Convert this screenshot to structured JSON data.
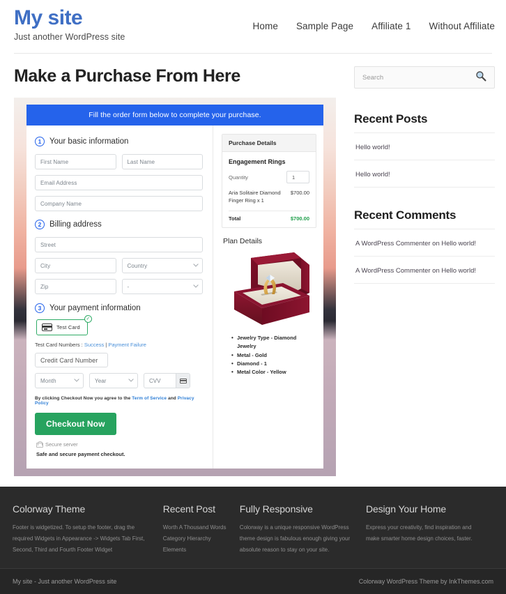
{
  "header": {
    "site_title": "My site",
    "tagline": "Just another WordPress site",
    "nav": [
      {
        "label": "Home"
      },
      {
        "label": "Sample Page"
      },
      {
        "label": "Affiliate 1"
      },
      {
        "label": "Without Affiliate"
      }
    ]
  },
  "main": {
    "page_title": "Make a Purchase From Here",
    "order_banner": "Fill the order form below to complete your purchase.",
    "steps": {
      "step1_num": "1",
      "step1_label": "Your basic information",
      "step2_num": "2",
      "step2_label": "Billing address",
      "step3_num": "3",
      "step3_label": "Your payment information"
    },
    "fields": {
      "first_name": "First Name",
      "last_name": "Last Name",
      "email": "Email Address",
      "company": "Company Name",
      "street": "Street",
      "city": "City",
      "country": "Country",
      "zip": "Zip",
      "state": "-",
      "credit_card_number": "Credit Card Number",
      "month": "Month",
      "year": "Year",
      "cvv": "CVV"
    },
    "payment": {
      "chip_label": "Test  Card",
      "chip_check": "✓",
      "testcard_prefix": "Test Card Numbers : ",
      "testcard_success": "Success",
      "testcard_sep": " | ",
      "testcard_failure": "Payment Failure",
      "terms_prefix": "By clicking Checkout Now you agree to the ",
      "terms_link1": "Term of Service",
      "terms_mid": " and ",
      "terms_link2": "Privacy Policy",
      "checkout_button": "Checkout Now",
      "secure_server": "Secure server",
      "safe_note": "Safe and secure payment checkout."
    },
    "purchase_details": {
      "heading": "Purchase Details",
      "product": "Engagement Rings",
      "quantity_label": "Quantity",
      "quantity_value": "1",
      "item_name": "Aria Solitaire Diamond Finger Ring x 1",
      "item_price": "$700.00",
      "total_label": "Total",
      "total_value": "$700.00"
    },
    "plan_details": {
      "heading": "Plan Details",
      "attributes": [
        "Jewelry Type - Diamond Jewelry",
        "Metal - Gold",
        "Diamond - 1",
        "Metal Color - Yellow"
      ]
    }
  },
  "sidebar": {
    "search_placeholder": "Search",
    "recent_posts": {
      "title": "Recent Posts",
      "items": [
        {
          "label": "Hello world!"
        },
        {
          "label": "Hello world!"
        }
      ]
    },
    "recent_comments": {
      "title": "Recent Comments",
      "items": [
        {
          "label": "A WordPress Commenter on Hello world!"
        },
        {
          "label": "A WordPress Commenter on Hello world!"
        }
      ]
    }
  },
  "footer": {
    "columns": [
      {
        "title": "Colorway Theme",
        "text": "Footer is widgetized. To setup the footer, drag the required Widgets in Appearance -> Widgets Tab First, Second, Third and Fourth Footer Widget"
      },
      {
        "title": "Recent Post",
        "links": [
          {
            "label": "Worth A Thousand Words"
          },
          {
            "label": "Category Hierarchy"
          },
          {
            "label": "Elements"
          }
        ]
      },
      {
        "title": "Fully Responsive",
        "text": "Colorway is a unique responsive WordPress theme design is fabulous enough giving your absolute reason to stay on your site."
      },
      {
        "title": "Design Your Home",
        "text": "Express your creativity, find inspiration and make smarter home design choices, faster."
      }
    ],
    "bar_left": "My site - Just another WordPress site",
    "bar_right": "Colorway WordPress Theme by InkThemes.com"
  },
  "colors": {
    "brand": "#3f6fc4",
    "banner": "#2563eb",
    "success": "#27a35f",
    "total": "#1e9e4a",
    "footer_bg": "#2b2b2b"
  }
}
